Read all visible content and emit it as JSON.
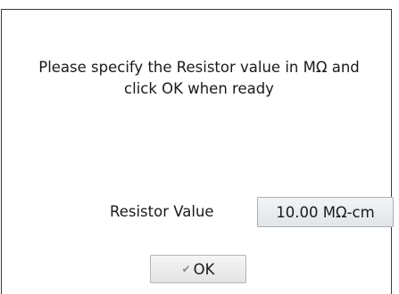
{
  "dialog": {
    "message_line1": "Please specify the Resistor value in MΩ and",
    "message_line2": "click OK when ready",
    "resistor_label": "Resistor Value",
    "resistor_value": "10.00 MΩ-cm",
    "ok_label": "OK",
    "ok_icon": "checkmark-icon"
  }
}
